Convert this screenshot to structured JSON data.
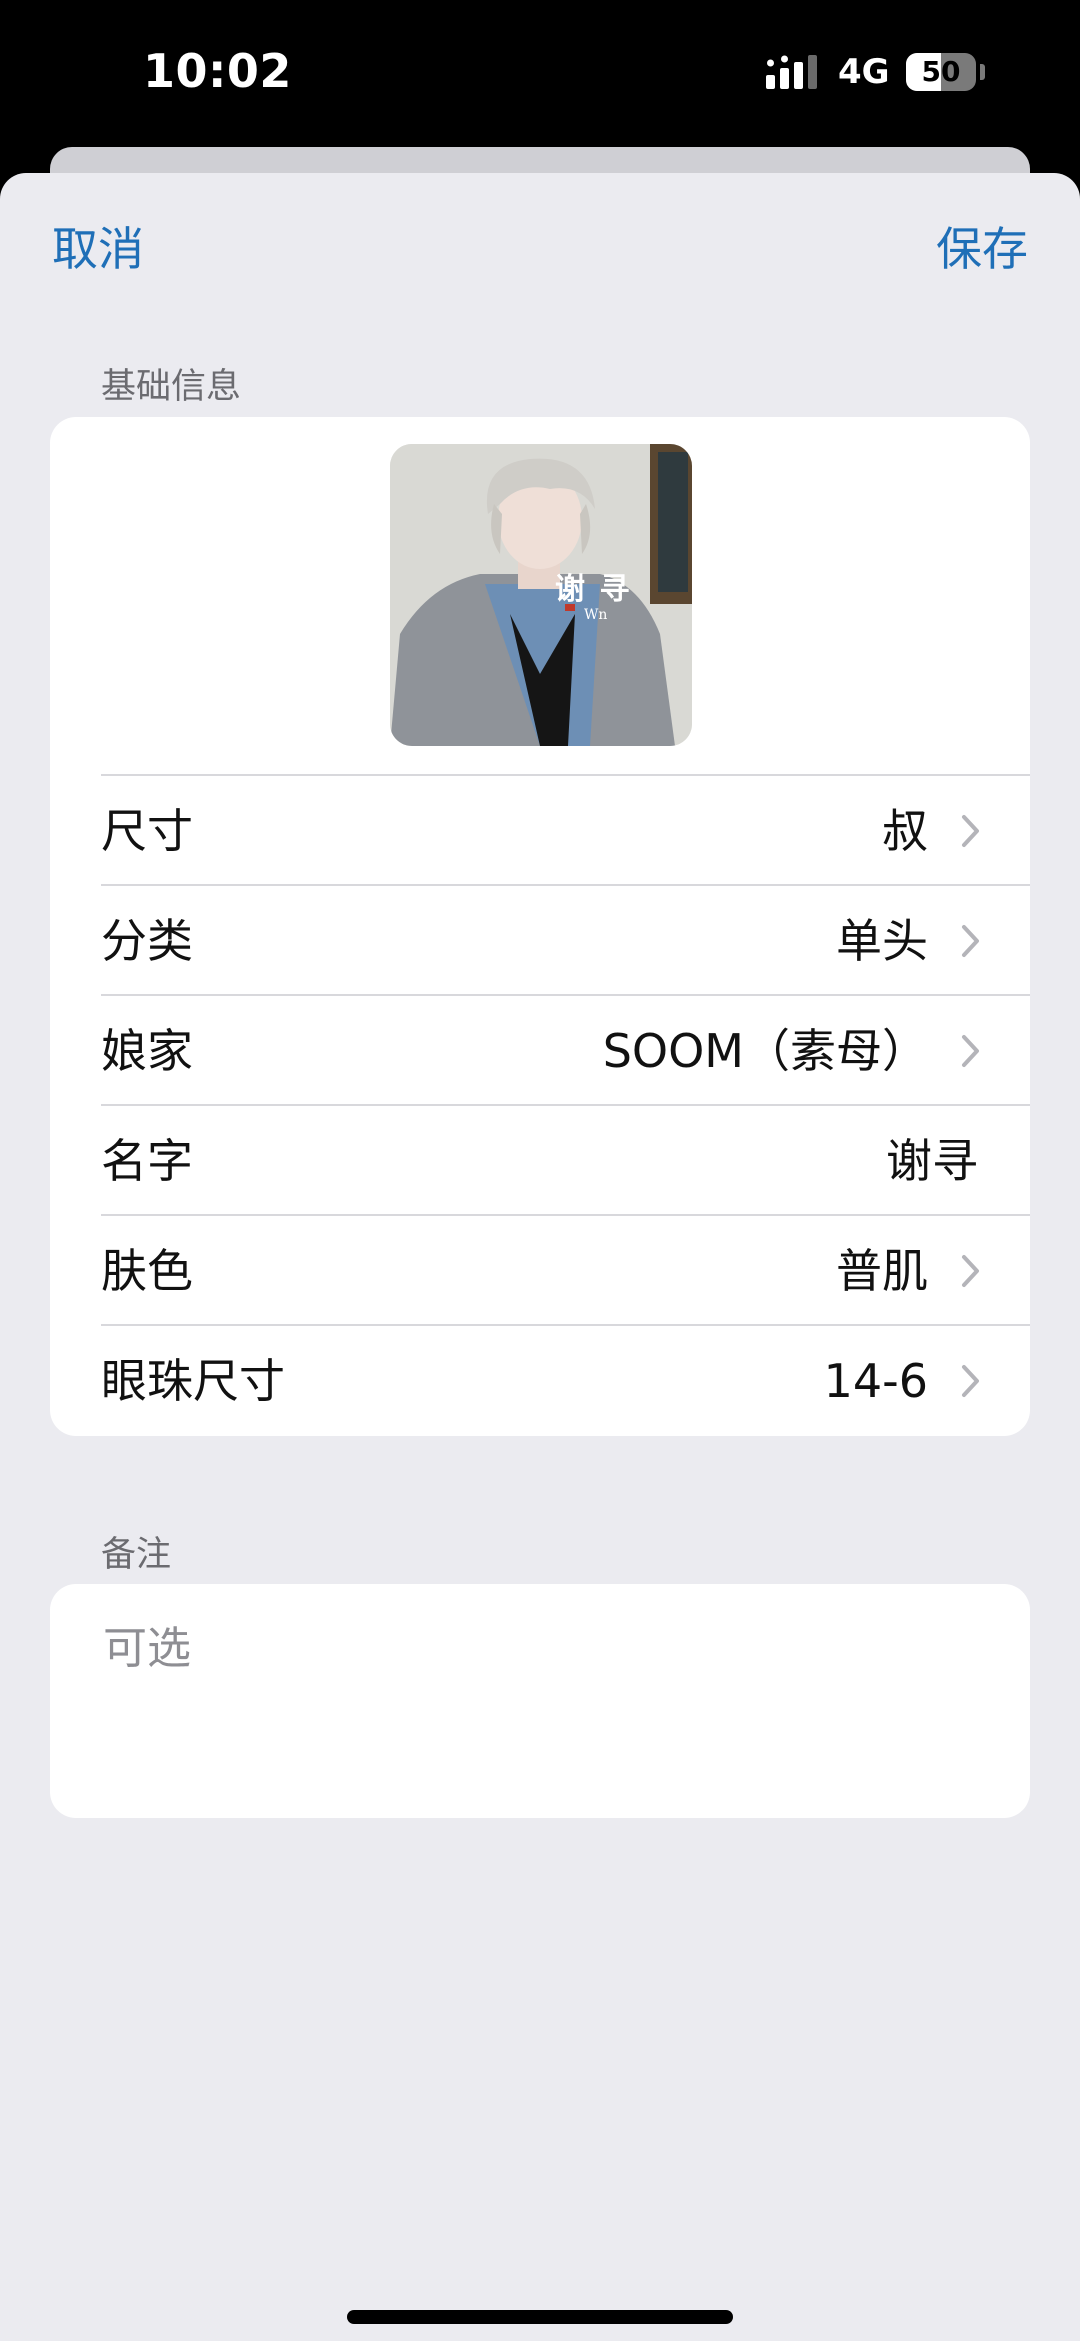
{
  "status_bar": {
    "time": "10:02",
    "network": "4G",
    "battery_level": "50",
    "battery_fraction": 0.5
  },
  "nav": {
    "cancel_label": "取消",
    "save_label": "保存"
  },
  "basic_info": {
    "section_title": "基础信息",
    "photo_caption": "谢 寻",
    "photo_sub": "Wn",
    "rows": [
      {
        "label": "尺寸",
        "value": "叔",
        "chevron": true
      },
      {
        "label": "分类",
        "value": "单头",
        "chevron": true
      },
      {
        "label": "娘家",
        "value": "SOOM（素母）",
        "chevron": true
      },
      {
        "label": "名字",
        "value": "谢寻",
        "chevron": false
      },
      {
        "label": "肤色",
        "value": "普肌",
        "chevron": true
      },
      {
        "label": "眼珠尺寸",
        "value": "14-6",
        "chevron": true
      }
    ]
  },
  "notes": {
    "section_title": "备注",
    "placeholder": "可选",
    "value": ""
  },
  "colors": {
    "accent": "#1f6fb7",
    "background": "#ebebf0",
    "card": "#ffffff",
    "secondary_text": "#6b6b70"
  }
}
